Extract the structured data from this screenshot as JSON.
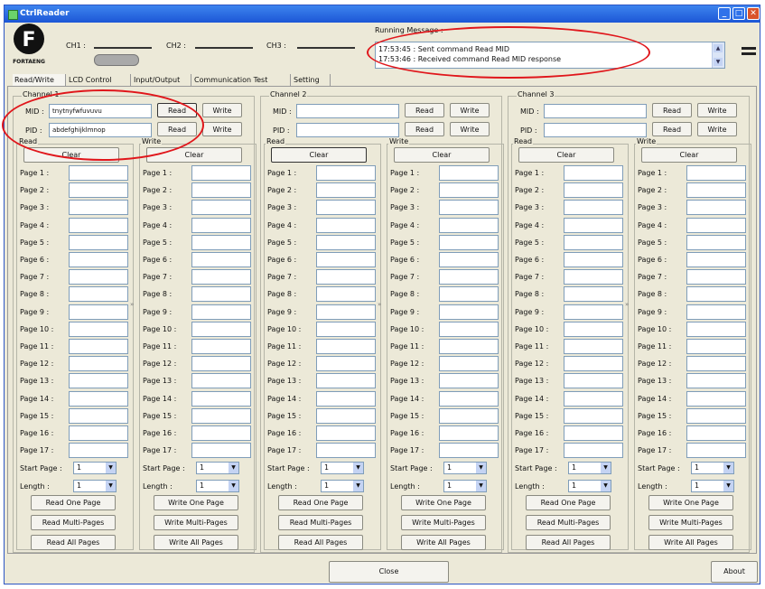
{
  "window": {
    "title": "CtrlReader",
    "controls": {
      "minimize": "_",
      "maximize": "□",
      "close": "✕"
    }
  },
  "header": {
    "logo_text": "FORTAENG",
    "channels": [
      "CH1 :",
      "CH2 :",
      "CH3 :"
    ],
    "running_label": "Running Message :",
    "messages": [
      "17:53:45 : Sent command Read MID",
      "17:53:46 : Received command Read MID response"
    ]
  },
  "tabs": [
    "Read/Write",
    "LCD Control",
    "Input/Output",
    "Communication Test",
    "Setting"
  ],
  "form": {
    "mid_label": "MID :",
    "pid_label": "PID :",
    "read_label": "Read",
    "write_label": "Write",
    "clear_label": "Clear",
    "start_page_label": "Start Page :",
    "length_label": "Length :",
    "read_one": "Read One Page",
    "read_multi": "Read Multi-Pages",
    "read_all": "Read All Pages",
    "write_one": "Write One Page",
    "write_multi": "Write Multi-Pages",
    "write_all": "Write All Pages"
  },
  "pages": [
    "Page 1 :",
    "Page 2 :",
    "Page 3 :",
    "Page 4 :",
    "Page 5 :",
    "Page 6 :",
    "Page 7 :",
    "Page 8 :",
    "Page 9 :",
    "Page 10 :",
    "Page 11 :",
    "Page 12 :",
    "Page 13 :",
    "Page 14 :",
    "Page 15 :",
    "Page 16 :",
    "Page 17 :"
  ],
  "channels": [
    {
      "title": "Channel 1",
      "mid": "tnytnyfwfuvuvu",
      "pid": "abdefghijklmnop",
      "start_page": "1",
      "length": "1"
    },
    {
      "title": "Channel 2",
      "mid": "",
      "pid": "",
      "start_page": "1",
      "length": "1"
    },
    {
      "title": "Channel 3",
      "mid": "",
      "pid": "",
      "start_page": "1",
      "length": "1"
    }
  ],
  "footer": {
    "close_label": "Close",
    "about_label": "About"
  },
  "colors": {
    "titlebar": "#1c56d6",
    "highlight": "#e0161b",
    "face": "#ece9d8"
  },
  "icons": {
    "dropdown": "▼",
    "scroll_up": "▲",
    "scroll_down": "▼",
    "transfer": "»"
  }
}
